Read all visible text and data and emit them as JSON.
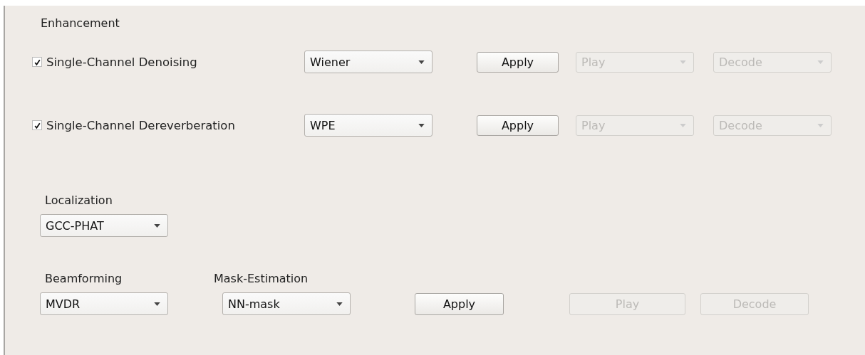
{
  "enhancement": {
    "title": "Enhancement",
    "rows": [
      {
        "label": "Single-Channel Denoising",
        "checked": true,
        "method": "Wiener",
        "apply": {
          "label": "Apply",
          "disabled": false
        },
        "play": {
          "label": "Play",
          "disabled": true
        },
        "decode": {
          "label": "Decode",
          "disabled": true
        }
      },
      {
        "label": "Single-Channel Dereverberation",
        "checked": true,
        "method": "WPE",
        "apply": {
          "label": "Apply",
          "disabled": false
        },
        "play": {
          "label": "Play",
          "disabled": true
        },
        "decode": {
          "label": "Decode",
          "disabled": true
        }
      }
    ]
  },
  "localization": {
    "title": "Localization",
    "method": "GCC-PHAT"
  },
  "beamforming": {
    "title": "Beamforming",
    "method": "MVDR"
  },
  "mask_estimation": {
    "title": "Mask-Estimation",
    "method": "NN-mask"
  },
  "actions": [
    {
      "label": "Apply",
      "disabled": false
    },
    {
      "label": "Play",
      "disabled": true
    },
    {
      "label": "Decode",
      "disabled": true
    }
  ]
}
